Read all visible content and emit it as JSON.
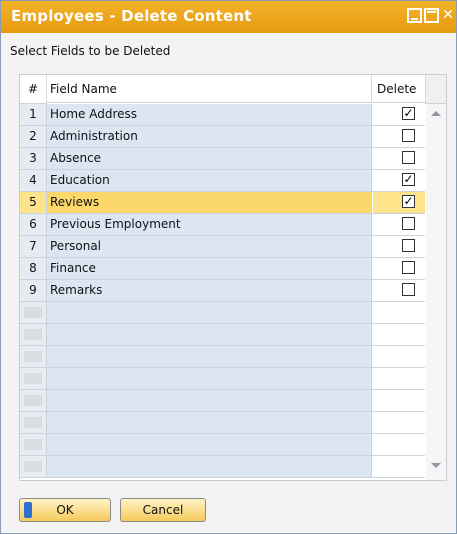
{
  "window": {
    "title": "Employees - Delete Content",
    "subtitle": "Select Fields to be Deleted"
  },
  "grid": {
    "columns": {
      "num": "#",
      "field": "Field Name",
      "delete": "Delete"
    },
    "rows": [
      {
        "num": "1",
        "field": "Home Address",
        "delete": true
      },
      {
        "num": "2",
        "field": "Administration",
        "delete": false
      },
      {
        "num": "3",
        "field": "Absence",
        "delete": false
      },
      {
        "num": "4",
        "field": "Education",
        "delete": true
      },
      {
        "num": "5",
        "field": "Reviews",
        "delete": true
      },
      {
        "num": "6",
        "field": "Previous Employment",
        "delete": false
      },
      {
        "num": "7",
        "field": "Personal",
        "delete": false
      },
      {
        "num": "8",
        "field": "Finance",
        "delete": false
      },
      {
        "num": "9",
        "field": "Remarks",
        "delete": false
      }
    ],
    "selected_row_num": "5",
    "empty_rows": 8
  },
  "buttons": {
    "ok": "OK",
    "cancel": "Cancel"
  },
  "colors": {
    "title_bar": "#e9a11a",
    "selected_row": "#fcd86a",
    "row_fill": "#dce6f2"
  }
}
